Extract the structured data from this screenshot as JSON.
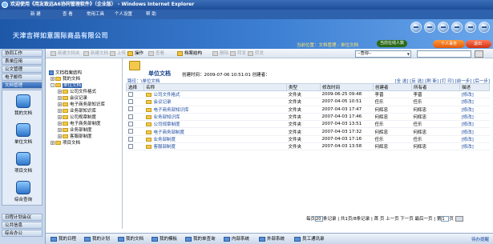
{
  "window": {
    "title": "欢迎使用《用友致远A6协同管理软件》（企业版） - Windows Internet Explorer"
  },
  "topmenu": [
    "新 建",
    "查 看",
    "常用工具",
    "个人设置",
    "帮 助"
  ],
  "banner": {
    "company": "天津吉祥如意国际商品有限公司",
    "location": "当前位置：文档管理 - 单位文档",
    "online": "当前在线人数",
    "btn_personal": "个人事务",
    "btn_exit": "退出"
  },
  "toolbar": {
    "buttons": [
      "新建文档夹",
      "新建文档",
      "上传",
      "操作",
      "查看",
      "档案结构",
      "删除",
      "转发",
      "转发"
    ],
    "select_value": "--查询--"
  },
  "sidebar": {
    "top_items": [
      "协同工作",
      "表单应用",
      "公文管理",
      "电子邮件",
      "文档管理"
    ],
    "panel_items": [
      "我的文档",
      "单位文档",
      "项目文档",
      "综合查询"
    ],
    "bottom_items": [
      "日程计划会议",
      "公共信息",
      "综合办公"
    ]
  },
  "tree": {
    "root": "文档档案结构",
    "my_docs": "我的文档",
    "unit_docs": "单位文档",
    "children": [
      "公司文件格式",
      "会议记录",
      "电子商务部知识库",
      "业务部知识库",
      "公司规章制度",
      "电子商务部制度",
      "业务部制度",
      "客服部制度"
    ],
    "project_docs": "项目文档"
  },
  "main": {
    "title": "单位文档",
    "created": "创建时间：2009-07-06 10:51:01  创建者：",
    "path": "路径：\\单位文档",
    "actions": "[全 选] [反 选] [刷 新] [打 印] [前一步] [后一步]",
    "columns": [
      "选择",
      "名称",
      "类型",
      "修改时间",
      "创建者",
      "所有者",
      "描述"
    ],
    "rows": [
      {
        "name": "公司文件格式",
        "type": "文件夹",
        "modified": "2009-06-25 09:48",
        "creator": "李晋",
        "owner": "李晋",
        "action": "[修改]"
      },
      {
        "name": "会议记录",
        "type": "文件夹",
        "modified": "2007-04-05 10:51",
        "creator": "任乐",
        "owner": "任乐",
        "action": "[修改]"
      },
      {
        "name": "电子商务部知识库",
        "type": "文件夹",
        "modified": "2007-04-03 17:47",
        "creator": "何辉忠",
        "owner": "何辉忠",
        "action": "[修改]"
      },
      {
        "name": "业务部知识库",
        "type": "文件夹",
        "modified": "2007-04-03 17:46",
        "creator": "何辉忠",
        "owner": "何辉忠",
        "action": "[修改]"
      },
      {
        "name": "公司规章制度",
        "type": "文件夹",
        "modified": "2007-04-03 13:51",
        "creator": "任乐",
        "owner": "任乐",
        "action": "[修改]"
      },
      {
        "name": "电子商务部制度",
        "type": "文件夹",
        "modified": "2007-04-03 17:32",
        "creator": "何辉忠",
        "owner": "何辉忠",
        "action": "[修改]"
      },
      {
        "name": "业务部制度",
        "type": "文件夹",
        "modified": "2007-04-03 17:16",
        "creator": "任乐",
        "owner": "任乐",
        "action": "[修改]"
      },
      {
        "name": "客服部制度",
        "type": "文件夹",
        "modified": "2007-04-03 13:58",
        "creator": "何辉忠",
        "owner": "何辉忠",
        "action": "[修改]"
      }
    ],
    "pager": {
      "per_page_label": "每页",
      "per_page": "20",
      "summary": "条记录 | 共1页/8条记录 | 首 页  上一页  下一页  最后一页 | 第",
      "page": "1",
      "page_unit": "页"
    }
  },
  "statusbar": {
    "items": [
      "我的日程",
      "我的计划",
      "我的文档",
      "我的模板",
      "我的单查询",
      "内部系统",
      "外部系统",
      "员工通讯录"
    ],
    "notify": "待办提醒"
  }
}
